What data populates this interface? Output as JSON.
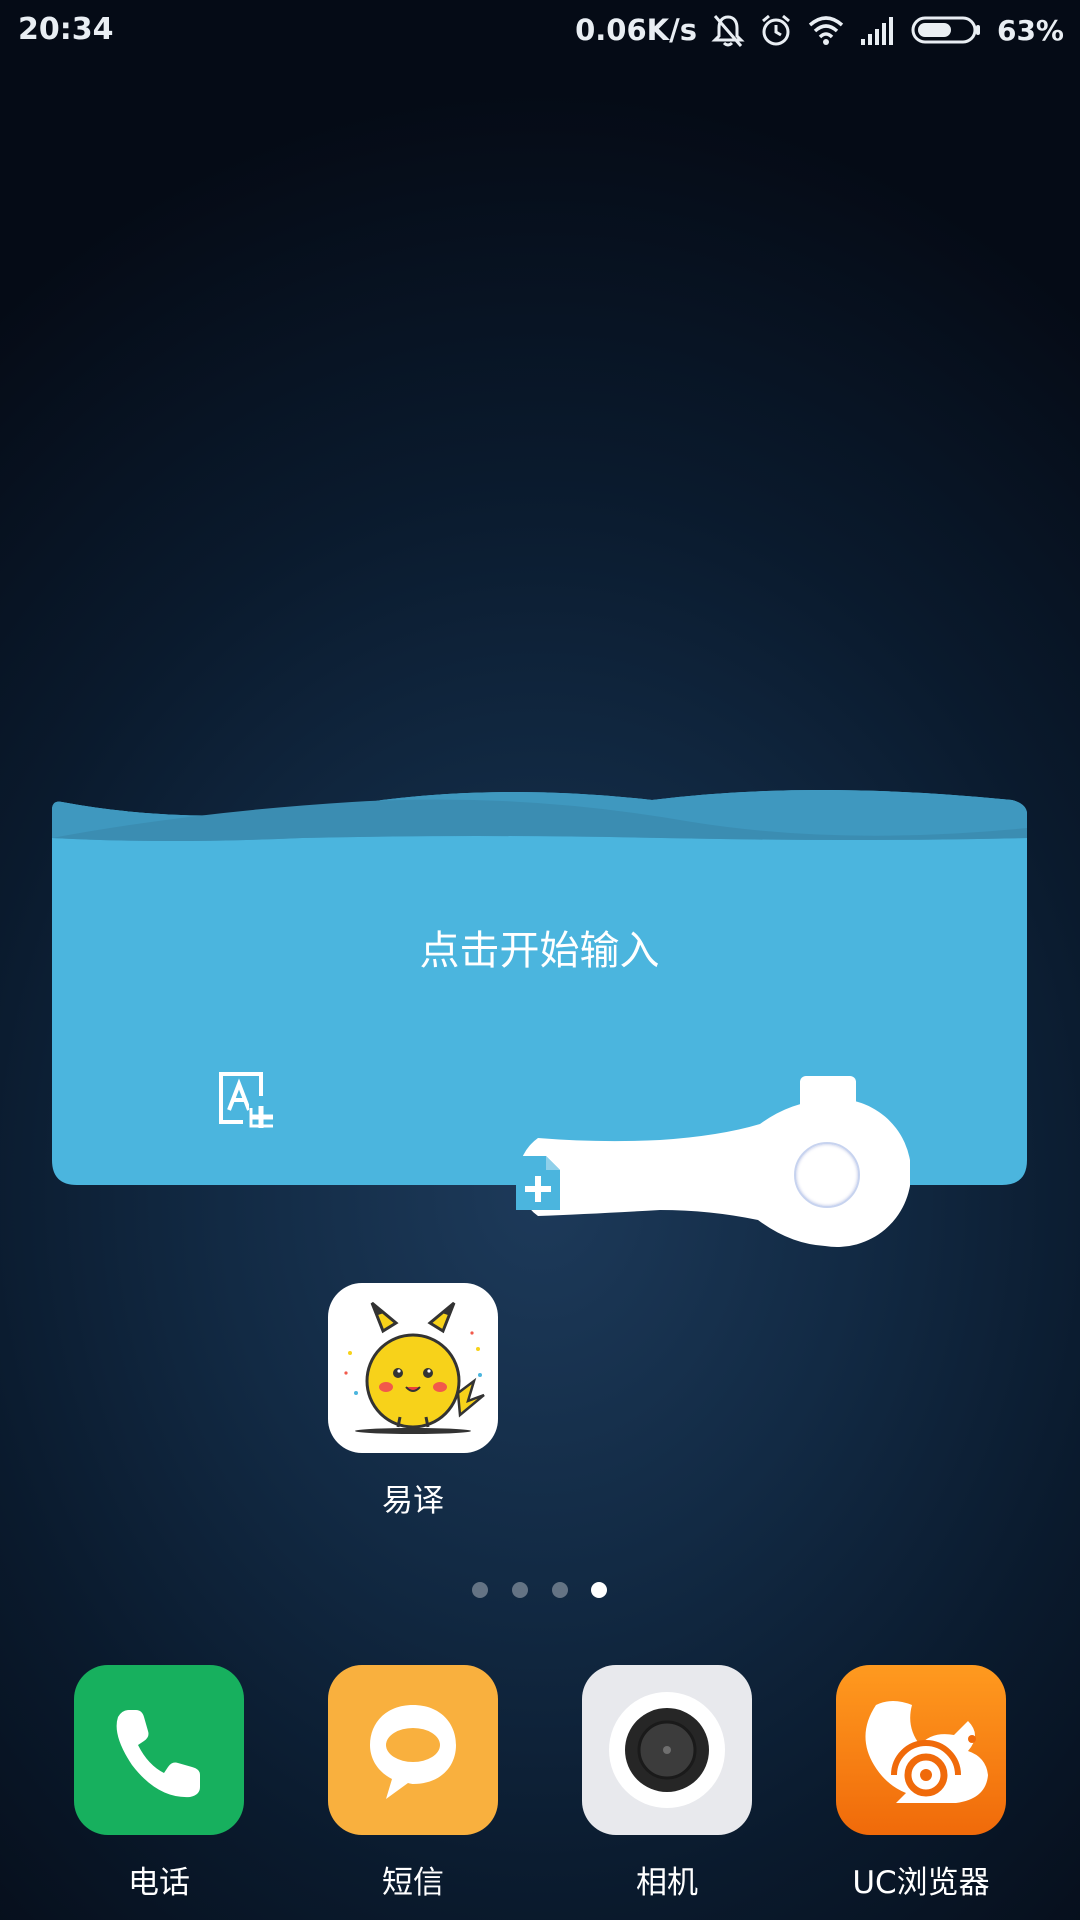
{
  "status_bar": {
    "time": "20:34",
    "net_speed": "0.06K/s",
    "battery_percent": "63%",
    "battery_level": 0.63,
    "icons": [
      "mute-bell-icon",
      "alarm-icon",
      "wifi-icon",
      "signal-icon",
      "battery-icon"
    ]
  },
  "widget": {
    "prompt": "点击开始输入",
    "accent_color": "#4bb5de",
    "icons": [
      "ocr-add-icon",
      "add-file-icon"
    ]
  },
  "apps": {
    "yiyi": {
      "label": "易译"
    },
    "dock": [
      {
        "label": "电话",
        "icon": "phone-icon",
        "color": "#17b05e"
      },
      {
        "label": "短信",
        "icon": "message-icon",
        "color": "#f9b03e"
      },
      {
        "label": "相机",
        "icon": "camera-icon",
        "color": "#e8e9ed"
      },
      {
        "label": "UC浏览器",
        "icon": "uc-browser-icon",
        "color": "#f97a10"
      }
    ]
  },
  "page_indicator": {
    "count": 4,
    "active_index": 3
  }
}
